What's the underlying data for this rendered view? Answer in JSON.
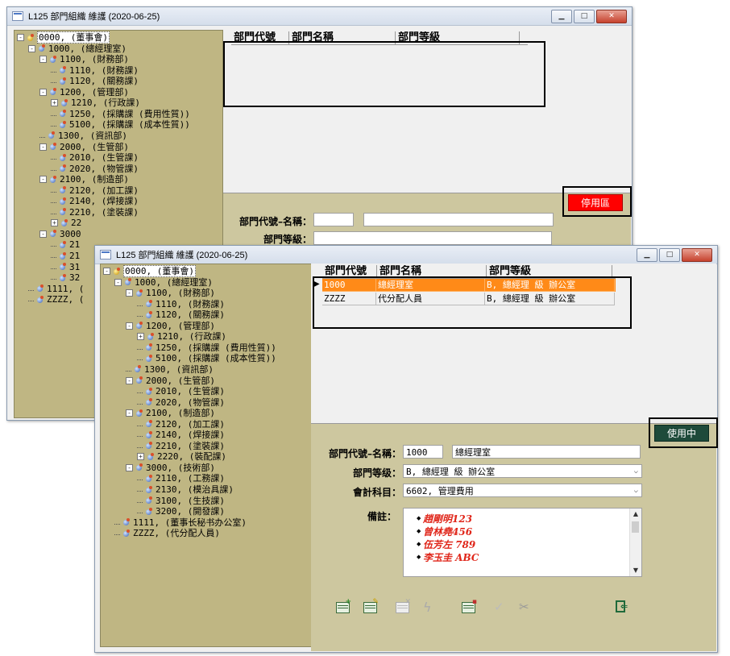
{
  "back_window": {
    "title": "L125 部門組織 維護 (2020-06-25)",
    "tree": [
      {
        "text": "0000, (董事會)",
        "level": 0,
        "exp": "-",
        "root": true
      },
      {
        "text": "1000, (總經理室)",
        "level": 1,
        "exp": "-"
      },
      {
        "text": "1100, (財務部)",
        "level": 2,
        "exp": "-"
      },
      {
        "text": "1110, (財務課)",
        "level": 3,
        "exp": ""
      },
      {
        "text": "1120, (關務課)",
        "level": 3,
        "exp": ""
      },
      {
        "text": "1200, (管理部)",
        "level": 2,
        "exp": "-"
      },
      {
        "text": "1210, (行政課)",
        "level": 3,
        "exp": "+"
      },
      {
        "text": "1250, (採購課 (費用性質))",
        "level": 3,
        "exp": ""
      },
      {
        "text": "5100, (採購課 (成本性質))",
        "level": 3,
        "exp": ""
      },
      {
        "text": "1300, (資訊部)",
        "level": 2,
        "exp": ""
      },
      {
        "text": "2000, (生管部)",
        "level": 2,
        "exp": "-"
      },
      {
        "text": "2010, (生管課)",
        "level": 3,
        "exp": ""
      },
      {
        "text": "2020, (物管課)",
        "level": 3,
        "exp": ""
      },
      {
        "text": "2100, (制造部)",
        "level": 2,
        "exp": "-"
      },
      {
        "text": "2120, (加工課)",
        "level": 3,
        "exp": ""
      },
      {
        "text": "2140, (焊接課)",
        "level": 3,
        "exp": ""
      },
      {
        "text": "2210, (塗裝課)",
        "level": 3,
        "exp": ""
      },
      {
        "text": "22",
        "level": 3,
        "exp": "+"
      },
      {
        "text": "3000",
        "level": 2,
        "exp": "-"
      },
      {
        "text": "21",
        "level": 3,
        "exp": ""
      },
      {
        "text": "21",
        "level": 3,
        "exp": ""
      },
      {
        "text": "31",
        "level": 3,
        "exp": ""
      },
      {
        "text": "32",
        "level": 3,
        "exp": ""
      },
      {
        "text": "1111, (",
        "level": 1,
        "exp": ""
      },
      {
        "text": "ZZZZ, (",
        "level": 1,
        "exp": ""
      }
    ],
    "grid_headers": [
      "部門代號",
      "部門名稱",
      "部門等級"
    ],
    "form": {
      "code_name_label": "部門代號–名稱：",
      "level_label": "部門等級："
    },
    "status_button": "停用區"
  },
  "front_window": {
    "title": "L125 部門組織 維護 (2020-06-25)",
    "tree": [
      {
        "text": "0000, (董事會)",
        "level": 0,
        "exp": "-",
        "root": true
      },
      {
        "text": "1000, (總經理室)",
        "level": 1,
        "exp": "-"
      },
      {
        "text": "1100, (財務部)",
        "level": 2,
        "exp": "-"
      },
      {
        "text": "1110, (財務課)",
        "level": 3,
        "exp": ""
      },
      {
        "text": "1120, (關務課)",
        "level": 3,
        "exp": ""
      },
      {
        "text": "1200, (管理部)",
        "level": 2,
        "exp": "-"
      },
      {
        "text": "1210, (行政課)",
        "level": 3,
        "exp": "+"
      },
      {
        "text": "1250, (採購課 (費用性質))",
        "level": 3,
        "exp": ""
      },
      {
        "text": "5100, (採購課 (成本性質))",
        "level": 3,
        "exp": ""
      },
      {
        "text": "1300, (資訊部)",
        "level": 2,
        "exp": ""
      },
      {
        "text": "2000, (生管部)",
        "level": 2,
        "exp": "-"
      },
      {
        "text": "2010, (生管課)",
        "level": 3,
        "exp": ""
      },
      {
        "text": "2020, (物管課)",
        "level": 3,
        "exp": ""
      },
      {
        "text": "2100, (制造部)",
        "level": 2,
        "exp": "-"
      },
      {
        "text": "2120, (加工課)",
        "level": 3,
        "exp": ""
      },
      {
        "text": "2140, (焊接課)",
        "level": 3,
        "exp": ""
      },
      {
        "text": "2210, (塗裝課)",
        "level": 3,
        "exp": ""
      },
      {
        "text": "2220, (裝配課)",
        "level": 3,
        "exp": "+"
      },
      {
        "text": "3000, (技術部)",
        "level": 2,
        "exp": "-"
      },
      {
        "text": "2110, (工務課)",
        "level": 3,
        "exp": ""
      },
      {
        "text": "2130, (模治具課)",
        "level": 3,
        "exp": ""
      },
      {
        "text": "3100, (生技課)",
        "level": 3,
        "exp": ""
      },
      {
        "text": "3200, (開發課)",
        "level": 3,
        "exp": ""
      },
      {
        "text": "1111, (董事长秘书办公室)",
        "level": 1,
        "exp": ""
      },
      {
        "text": "ZZZZ, (代分配人員)",
        "level": 1,
        "exp": ""
      }
    ],
    "grid_headers": [
      "部門代號",
      "部門名稱",
      "部門等級"
    ],
    "grid_rows": [
      {
        "code": "1000",
        "name": "總經理室",
        "level": "B, 總經理 級 辦公室",
        "active": true
      },
      {
        "code": "ZZZZ",
        "name": "代分配人員",
        "level": "B, 總經理 級 辦公室",
        "active": false
      }
    ],
    "status_button": "使用中",
    "form": {
      "code_name_label": "部門代號–名稱：",
      "code": "1000",
      "name": "總經理室",
      "level_label": "部門等级：",
      "level_value": "B, 總經理 級 辦公室",
      "account_label": "會計科目：",
      "account_value": "6602, 管理費用",
      "note_label": "備註：",
      "notes": [
        "趙剛明123",
        "曾林堯456",
        "伍芳左 789",
        "李玉圭 ABC"
      ]
    },
    "toolbar": [
      "add-record",
      "edit-record",
      "delete-record",
      "lightning",
      "grid-record",
      "confirm",
      "cut"
    ]
  },
  "colors": {
    "tree_bg": "#bfb683",
    "form_bg": "#cdc79f",
    "active_row": "#ff8a18",
    "stop_btn": "#ff0000",
    "active_btn": "#1e4a3a"
  }
}
